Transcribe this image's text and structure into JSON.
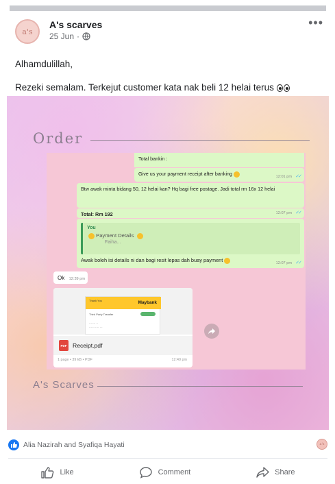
{
  "post": {
    "page_name": "A's scarves",
    "avatar_text": "a's",
    "date": "25 Jun",
    "meta_separator": "·",
    "more_label": "•••",
    "caption_line1": "Alhamdulillah,",
    "caption_line2": "Rezeki semalam. Terkejut customer kata nak beli 12 helai terus"
  },
  "image": {
    "order_title": "Order",
    "brand_title": "A's Scarves",
    "chat": {
      "msg1": "Total bankin :",
      "msg2": "Give us your payment receipt after banking",
      "msg2_time": "12:01 pm",
      "msg3": "Btw awak minta bidang 50, 12 helai kan? Hq bagi free postage. Jadi total rm 16x 12 helai",
      "msg4": "Total: Rm 192",
      "msg4_time": "12:07 pm",
      "quote_you": "You",
      "quote_title": "Payment Details",
      "quote_sub": "Faiha...",
      "msg5": "Awak boleh isi details ni dan bagi resit lepas dah buay payment",
      "msg5_time": "12:07 pm",
      "msg6": "Ok",
      "msg6_time": "12:39 pm",
      "thumb_text": "Thank You",
      "thumb_bank": "Maybank",
      "thumb_row": "Third Party Transfer",
      "file_name": "Receipt.pdf",
      "file_icon": "PDF",
      "file_meta": "1 page • 39 kB • PDF",
      "file_time": "12:40 pm"
    }
  },
  "footer": {
    "reactors": "Alia Nazirah and Syafiqa Hayati",
    "like": "Like",
    "comment": "Comment",
    "share": "Share"
  },
  "colors": {
    "facebook_blue": "#1877f2",
    "whatsapp_out": "#dcf8c6",
    "chat_background": "#f6c7d6"
  },
  "icons": [
    "globe-icon",
    "more-icon",
    "like-badge-icon",
    "like-icon",
    "comment-icon",
    "share-icon",
    "pdf-icon",
    "forward-icon",
    "eyes-emoji-icon",
    "read-ticks-icon"
  ]
}
